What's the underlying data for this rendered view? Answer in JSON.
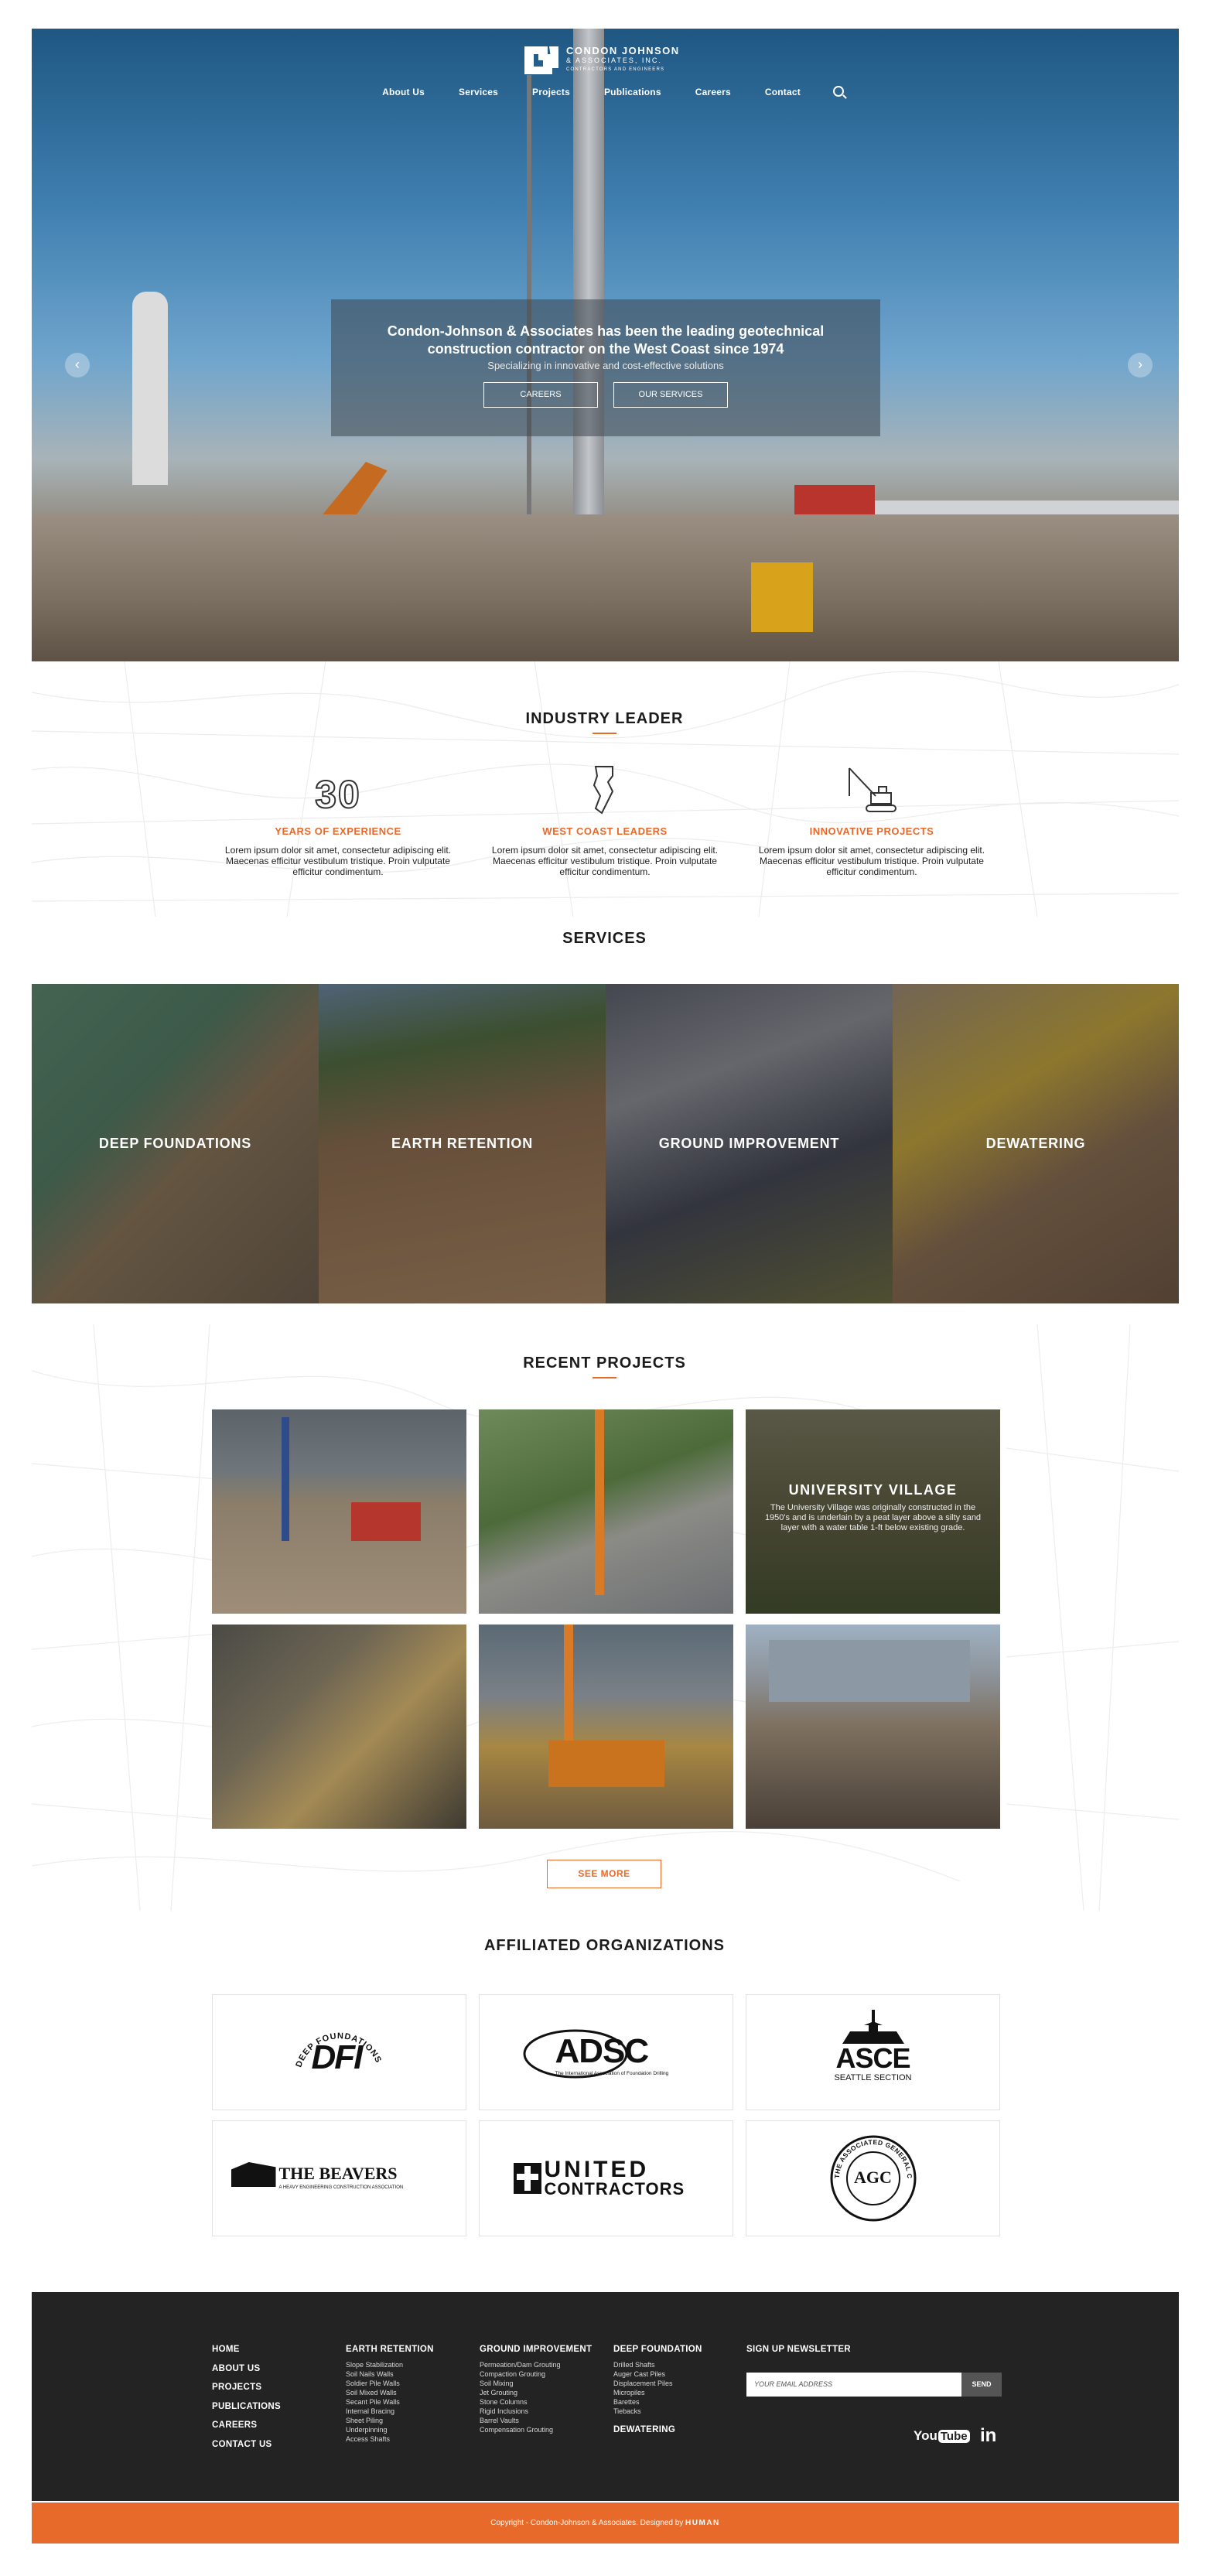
{
  "brand": {
    "line1": "CONDON JOHNSON",
    "line2": "& ASSOCIATES, INC.",
    "line3": "CONTRACTORS AND ENGINEERS"
  },
  "nav": [
    "About Us",
    "Services",
    "Projects",
    "Publications",
    "Careers",
    "Contact"
  ],
  "hero": {
    "headline": "Condon-Johnson & Associates has been the leading geotechnical construction contractor on the West Coast since 1974",
    "subline": "Specializing in innovative and cost-effective solutions",
    "buttons": [
      "CAREERS",
      "OUR SERVICES"
    ],
    "prev": "‹",
    "next": "›"
  },
  "industry": {
    "title": "INDUSTRY LEADER",
    "items": [
      {
        "icon": "thirty",
        "big": "30",
        "title": "YEARS OF EXPERIENCE",
        "text": "Lorem ipsum dolor sit amet, consectetur adipiscing elit. Maecenas efficitur vestibulum tristique. Proin vulputate efficitur condimentum."
      },
      {
        "icon": "west-coast-map",
        "title": "WEST COAST LEADERS",
        "text": "Lorem ipsum dolor sit amet, consectetur adipiscing elit. Maecenas efficitur vestibulum tristique. Proin vulputate efficitur condimentum."
      },
      {
        "icon": "drill-rig",
        "title": "INNOVATIVE PROJECTS",
        "text": "Lorem ipsum dolor sit amet, consectetur adipiscing elit. Maecenas efficitur vestibulum tristique. Proin vulputate efficitur condimentum."
      }
    ]
  },
  "services": {
    "title": "SERVICES",
    "items": [
      "DEEP FOUNDATIONS",
      "EARTH RETENTION",
      "GROUND IMPROVEMENT",
      "DEWATERING"
    ]
  },
  "projects": {
    "title": "RECENT PROJECTS",
    "featured": {
      "name": "UNIVERSITY VILLAGE",
      "text": "The University Village was originally constructed in the 1950's and is underlain by a peat layer above a silty sand layer with a water table 1-ft below existing grade."
    },
    "see_more": "SEE MORE"
  },
  "affiliated": {
    "title": "AFFILIATED ORGANIZATIONS",
    "orgs": {
      "dfi": "DFI",
      "dfi_arc": "DEEP FOUNDATIONS INSTITUTE",
      "adsc": "ADSC",
      "adsc_sub": "The International Association of Foundation Drilling",
      "asce": "ASCE",
      "asce_sub": "SEATTLE SECTION",
      "beavers": "THE BEAVERS",
      "beavers_sub": "A HEAVY ENGINEERING CONSTRUCTION ASSOCIATION",
      "united1": "UNITED",
      "united2": "CONTRACTORS",
      "agc": "AGC",
      "agc_arc": "THE ASSOCIATED GENERAL CONTRACTORS OF AMERICA"
    }
  },
  "footer": {
    "main": [
      "HOME",
      "ABOUT US",
      "PROJECTS",
      "PUBLICATIONS",
      "CAREERS",
      "CONTACT US"
    ],
    "earth_retention": {
      "title": "EARTH RETENTION",
      "items": [
        "Slope Stabilization",
        "Soil Nails Walls",
        "Soldier Pile Walls",
        "Soil Mixed Walls",
        "Secant Pile Walls",
        "Internal Bracing",
        "Sheet Piling",
        "Underpinning",
        "Access Shafts"
      ]
    },
    "ground_improvement": {
      "title": "GROUND IMPROVEMENT",
      "items": [
        "Permeation/Dam Grouting",
        "Compaction Grouting",
        "Soil Mixing",
        "Jet Grouting",
        "Stone Columns",
        "Rigid Inclusions",
        "Barrel Vaults",
        "Compensation Grouting"
      ]
    },
    "deep_foundation": {
      "title": "DEEP FOUNDATION",
      "items": [
        "Drilled Shafts",
        "Auger Cast Piles",
        "Displacement Piles",
        "Micropiles",
        "Barettes",
        "Tiebacks"
      ]
    },
    "dewatering": "DEWATERING",
    "newsletter": {
      "title": "SIGN UP NEWSLETTER",
      "placeholder": "YOUR EMAIL ADDRESS",
      "send": "SEND"
    },
    "youtube_1": "You",
    "youtube_2": "Tube",
    "linkedin": "in"
  },
  "copyright": {
    "text": "Copyright - Condon-Johnson & Associates. Designed by ",
    "designer": "HUMAN"
  },
  "colors": {
    "accent": "#e86a2a",
    "footer": "#232323"
  }
}
